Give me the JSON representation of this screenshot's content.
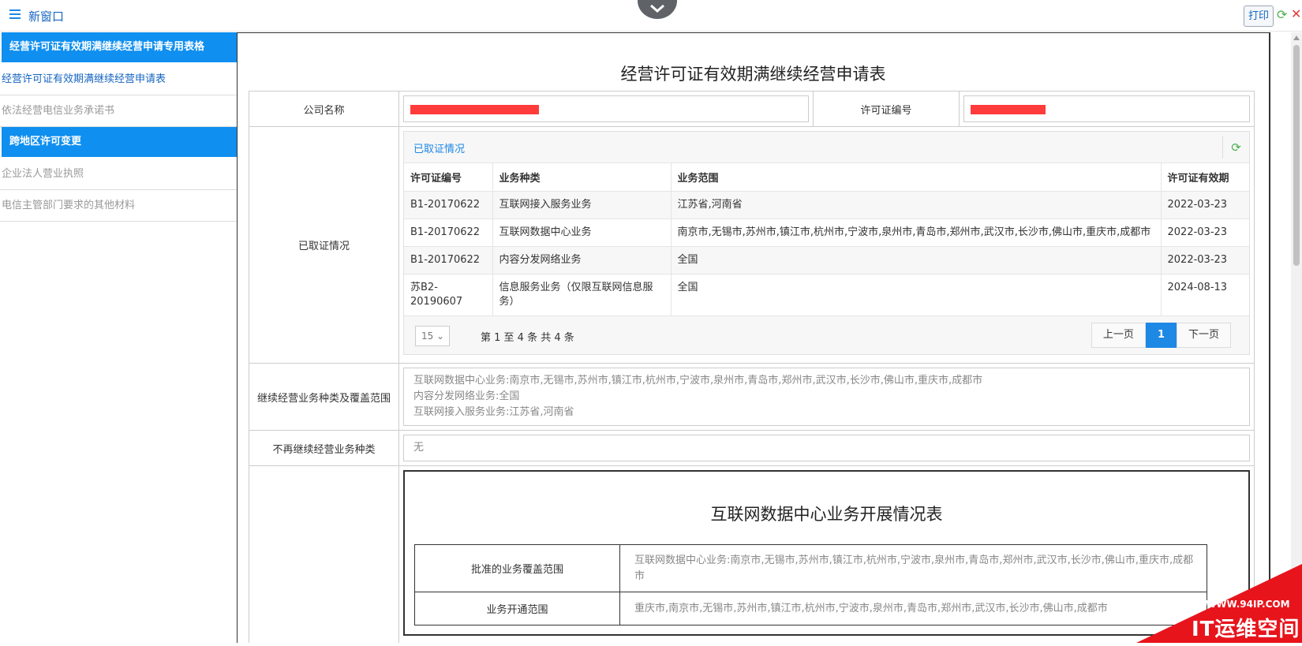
{
  "window": {
    "title": "新窗口",
    "print_label": "打印"
  },
  "sidebar": {
    "items": [
      {
        "label": "经营许可证有效期满继续经营申请专用表格",
        "type": "header"
      },
      {
        "label": "经营许可证有效期满继续经营申请表",
        "type": "active"
      },
      {
        "label": "依法经营电信业务承诺书",
        "type": "item"
      },
      {
        "label": "跨地区许可变更",
        "type": "header"
      },
      {
        "label": "企业法人营业执照",
        "type": "item"
      },
      {
        "label": "电信主管部门要求的其他材料",
        "type": "item"
      }
    ]
  },
  "form": {
    "title": "经营许可证有效期满继续经营申请表",
    "company_label": "公司名称",
    "license_no_label": "许可证编号",
    "obtained_label": "已取证情况",
    "obtained_panel_title": "已取证情况",
    "license_table": {
      "headers": [
        "许可证编号",
        "业务种类",
        "业务范围",
        "许可证有效期"
      ],
      "rows": [
        [
          "B1-20170622",
          "互联网接入服务业务",
          "江苏省,河南省",
          "2022-03-23"
        ],
        [
          "B1-20170622",
          "互联网数据中心业务",
          "南京市,无锡市,苏州市,镇江市,杭州市,宁波市,泉州市,青岛市,郑州市,武汉市,长沙市,佛山市,重庆市,成都市",
          "2022-03-23"
        ],
        [
          "B1-20170622",
          "内容分发网络业务",
          "全国",
          "2022-03-23"
        ],
        [
          "苏B2-20190607",
          "信息服务业务（仅限互联网信息服务）",
          "全国",
          "2024-08-13"
        ]
      ]
    },
    "pager": {
      "page_size": "15",
      "info": "第 1 至 4 条 共 4 条",
      "prev": "上一页",
      "current": "1",
      "next": "下一页"
    },
    "continue_label": "继续经营业务种类及覆盖范围",
    "continue_lines": [
      "互联网数据中心业务:南京市,无锡市,苏州市,镇江市,杭州市,宁波市,泉州市,青岛市,郑州市,武汉市,长沙市,佛山市,重庆市,成都市",
      "内容分发网络业务:全国",
      "互联网接入服务业务:江苏省,河南省"
    ],
    "discontinue_label": "不再继续经营业务种类",
    "discontinue_value": "无",
    "sub_form": {
      "title": "互联网数据中心业务开展情况表",
      "rows": [
        {
          "label": "批准的业务覆盖范围",
          "value": "互联网数据中心业务:南京市,无锡市,苏州市,镇江市,杭州市,宁波市,泉州市,青岛市,郑州市,武汉市,长沙市,佛山市,重庆市,成都市"
        },
        {
          "label": "业务开通范围",
          "value": "重庆市,南京市,无锡市,苏州市,镇江市,杭州市,宁波市,泉州市,青岛市,郑州市,武汉市,长沙市,佛山市,成都市"
        }
      ]
    }
  },
  "watermark": {
    "url": "WWW.94IP.COM",
    "name": "IT运维空间"
  },
  "colors": {
    "accent": "#0f8ff0",
    "link": "#1565c0",
    "redaction": "#ff3b3b"
  }
}
